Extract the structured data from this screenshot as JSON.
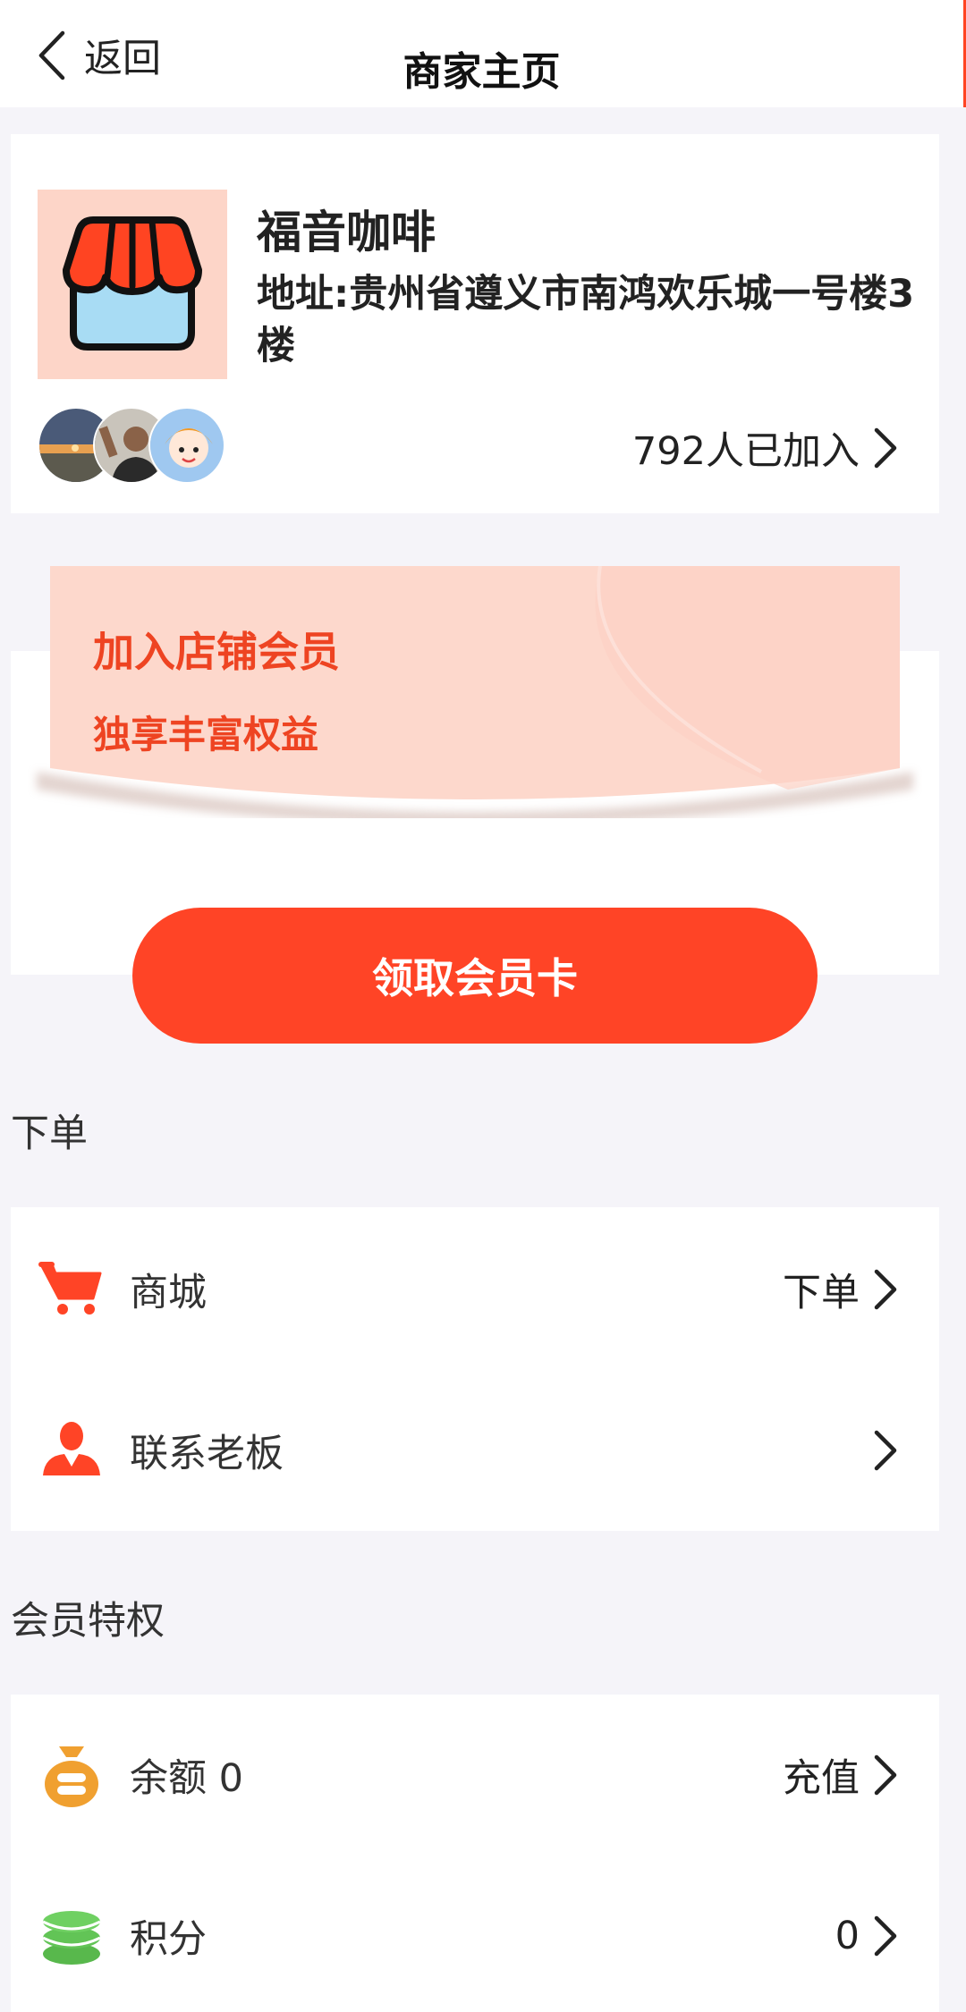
{
  "header": {
    "back_label": "返回",
    "title": "商家主页"
  },
  "shop": {
    "name": "福音咖啡",
    "address": "地址:贵州省遵义市南鸿欢乐城一号楼3楼",
    "joined_text": "792人已加入"
  },
  "member": {
    "title": "加入店铺会员",
    "subtitle": "独享丰富权益",
    "claim_button": "领取会员卡"
  },
  "order_section": {
    "label": "下单",
    "items": [
      {
        "label": "商城",
        "right_text": "下单",
        "icon": "shopping-cart-icon"
      },
      {
        "label": "联系老板",
        "right_text": "",
        "icon": "person-icon"
      }
    ]
  },
  "privilege_section": {
    "label": "会员特权",
    "items": [
      {
        "label": "余额 0",
        "right_text": "充值",
        "icon": "money-bag-icon"
      },
      {
        "label": "积分",
        "right_text": "0",
        "icon": "coin-stack-icon"
      }
    ]
  },
  "colors": {
    "accent": "#ff4426",
    "banner": "#fdd8cc",
    "background": "#f5f4f9"
  }
}
